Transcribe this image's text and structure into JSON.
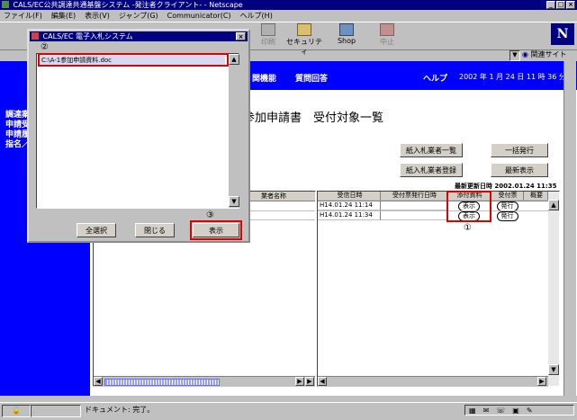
{
  "window": {
    "title": "CALS/EC公共調達共通基盤システム -発注者クライアント- - Netscape"
  },
  "menu": [
    "ファイル(F)",
    "編集(E)",
    "表示(V)",
    "ジャンプ(G)",
    "Communicator(C)",
    "ヘルプ(H)"
  ],
  "toolbar": {
    "print": "印刷",
    "security": "セキュリティ",
    "shop": "Shop",
    "stop": "中止"
  },
  "location": {
    "related_label": "関連サイト"
  },
  "site_nav": {
    "item1": "関機能",
    "item2": "質問回答",
    "item3": "ヘルプ",
    "datetime": "2002 年  1 月 24 日  11 時 36 分"
  },
  "sidebar_links": [
    "調達案",
    "申請受",
    "申請履",
    "指名／"
  ],
  "page": {
    "title": "参加申請書　受付対象一覧"
  },
  "buttons": {
    "bid_list": "紙入札業者一覧",
    "bulk_issue": "一括発行",
    "bid_register": "紙入札業者登録",
    "latest": "最新表示"
  },
  "updated": "最新更新日時 2002.01.24 11:35",
  "table": {
    "left_header": "業者名称",
    "columns": [
      "受信日時",
      "受付票発行日時",
      "添付資料",
      "受付票",
      "概要"
    ],
    "rows": [
      {
        "received": "H14.01.24 11:14",
        "attach": "表示",
        "slip": "発行"
      },
      {
        "received": "H14.01.24 11:34",
        "attach": "表示",
        "slip": "発行"
      }
    ]
  },
  "dialog": {
    "title": "CALS/EC 電子入札システム",
    "file_item": "C:\\A-1参加申請資料.doc",
    "btn_select_all": "全選択",
    "btn_close": "閉じる",
    "btn_display": "表示"
  },
  "annotations": {
    "one": "①",
    "two": "②",
    "three": "③"
  },
  "status": {
    "text": "ドキュメント: 完了。"
  },
  "colors": {
    "titlebar": "#000080",
    "accent_blue": "#0000ff",
    "highlight_red": "#e00000"
  }
}
